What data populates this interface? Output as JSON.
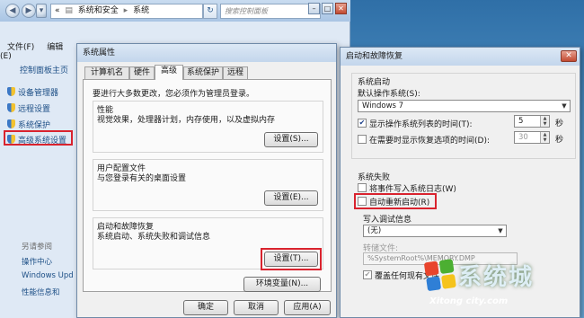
{
  "explorer": {
    "address": {
      "part1": "系统和安全",
      "part2": "系统",
      "chevron": "«"
    },
    "search_placeholder": "搜索控制面板",
    "menu": {
      "file": "文件(F)",
      "edit": "编辑(E)"
    },
    "sidebar": {
      "home": "控制面板主页",
      "items": [
        "设备管理器",
        "远程设置",
        "系统保护",
        "高级系统设置"
      ]
    },
    "see_also": {
      "title": "另请参阅",
      "items": [
        "操作中心",
        "Windows Upd",
        "性能信息和"
      ]
    }
  },
  "sysprops": {
    "title": "系统属性",
    "tabs": [
      "计算机名",
      "硬件",
      "高级",
      "系统保护",
      "远程"
    ],
    "active_tab": "高级",
    "note": "要进行大多数更改，您必须作为管理员登录。",
    "groups": [
      {
        "title": "性能",
        "desc": "视觉效果，处理器计划，内存使用，以及虚拟内存",
        "button": "设置(S)..."
      },
      {
        "title": "用户配置文件",
        "desc": "与您登录有关的桌面设置",
        "button": "设置(E)..."
      },
      {
        "title": "启动和故障恢复",
        "desc": "系统启动、系统失败和调试信息",
        "button": "设置(T)..."
      }
    ],
    "env_button": "环境变量(N)...",
    "ok_button": "确定",
    "cancel_button": "取消",
    "apply_button": "应用(A)"
  },
  "recovery": {
    "title": "启动和故障恢复",
    "startup": {
      "group_title": "系统启动",
      "default_os_label": "默认操作系统(S):",
      "default_os_value": "Windows 7",
      "show_os_list_label": "显示操作系统列表的时间(T):",
      "show_os_list_checked": true,
      "show_os_list_value": "5",
      "show_recovery_label": "在需要时显示恢复选项的时间(D):",
      "show_recovery_checked": false,
      "show_recovery_value": "30",
      "unit": "秒"
    },
    "failure": {
      "group_title": "系统失败",
      "write_event_label": "将事件写入系统日志(W)",
      "auto_restart_label": "自动重新启动(R)",
      "debug_info_label": "写入调试信息",
      "debug_value": "(无)",
      "dump_file_label": "转储文件:",
      "dump_file_value": "%SystemRoot%\\MEMORY.DMP",
      "overwrite_label": "覆盖任何现有文件"
    },
    "close_glyph": "✕"
  },
  "watermark": {
    "text": "系统城",
    "sub": "Xitong city.com"
  },
  "colors": {
    "highlight": "#d9232e",
    "accent": "#1d4f86"
  }
}
